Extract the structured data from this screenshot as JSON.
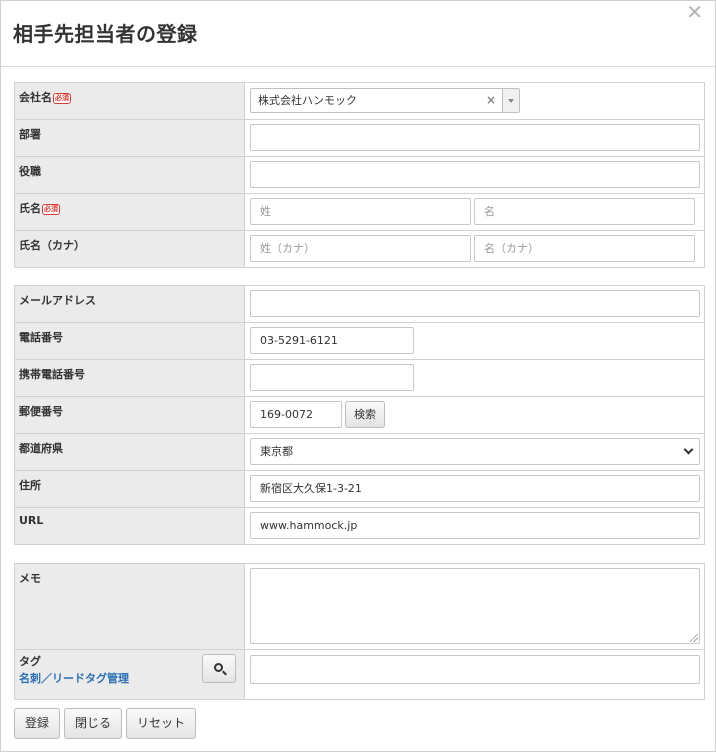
{
  "dialog": {
    "title": "相手先担当者の登録",
    "close_glyph": "✕"
  },
  "section1": {
    "company": {
      "label": "会社名",
      "required": "必須",
      "value": "株式会社ハンモック",
      "clear_glyph": "×"
    },
    "department": {
      "label": "部署",
      "value": ""
    },
    "position": {
      "label": "役職",
      "value": ""
    },
    "name": {
      "label": "氏名",
      "required": "必須",
      "last_placeholder": "姓",
      "first_placeholder": "名"
    },
    "name_kana": {
      "label": "氏名（カナ）",
      "last_placeholder": "姓（カナ）",
      "first_placeholder": "名（カナ）"
    }
  },
  "section2": {
    "email": {
      "label": "メールアドレス",
      "value": ""
    },
    "phone": {
      "label": "電話番号",
      "value": "03-5291-6121"
    },
    "mobile": {
      "label": "携帯電話番号",
      "value": ""
    },
    "postal": {
      "label": "郵便番号",
      "value": "169-0072",
      "search_button": "検索"
    },
    "prefecture": {
      "label": "都道府県",
      "value": "東京都"
    },
    "address": {
      "label": "住所",
      "value": "新宿区大久保1-3-21"
    },
    "url": {
      "label": "URL",
      "value": "www.hammock.jp"
    }
  },
  "section3": {
    "memo": {
      "label": "メモ",
      "value": ""
    },
    "tag": {
      "label": "タグ",
      "manage_link": "名刺／リードタグ管理",
      "value": "",
      "icon": "search-icon"
    }
  },
  "footer": {
    "register": "登録",
    "close": "閉じる",
    "reset": "リセット"
  }
}
